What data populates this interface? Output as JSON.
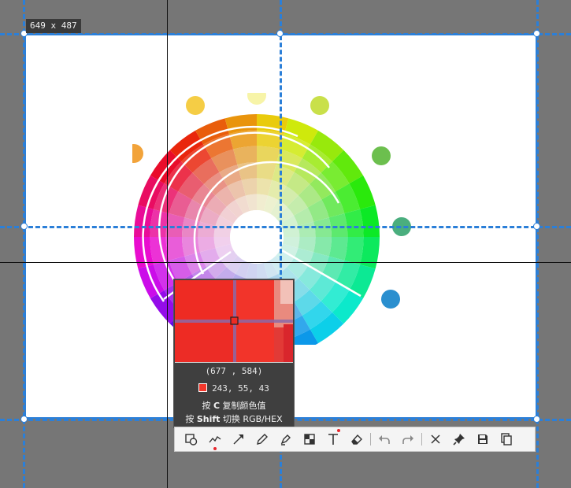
{
  "selection_size_label": "649 x 487",
  "picker": {
    "coordinates": "(677 , 584)",
    "rgb": "243,  55,  43",
    "swatch_color": "#f3372b",
    "hint_copy_prefix": "按",
    "hint_copy_key": "C",
    "hint_copy_suffix": "复制颜色值",
    "hint_switch_prefix": "按",
    "hint_switch_key": "Shift",
    "hint_switch_suffix": "切换 RGB/HEX"
  },
  "colors": {
    "accent": "#2b7fd8",
    "toolbar_bg": "#f4f4f4",
    "marker_dot": "#e8262c"
  },
  "toolbar": {
    "tools": [
      "shapes-icon",
      "freehand-line-icon",
      "arrow-icon",
      "pencil-icon",
      "highlighter-icon",
      "mosaic-icon",
      "text-icon",
      "eraser-icon",
      "undo-icon",
      "redo-icon",
      "close-icon",
      "pin-icon",
      "save-icon",
      "copy-icon"
    ]
  }
}
